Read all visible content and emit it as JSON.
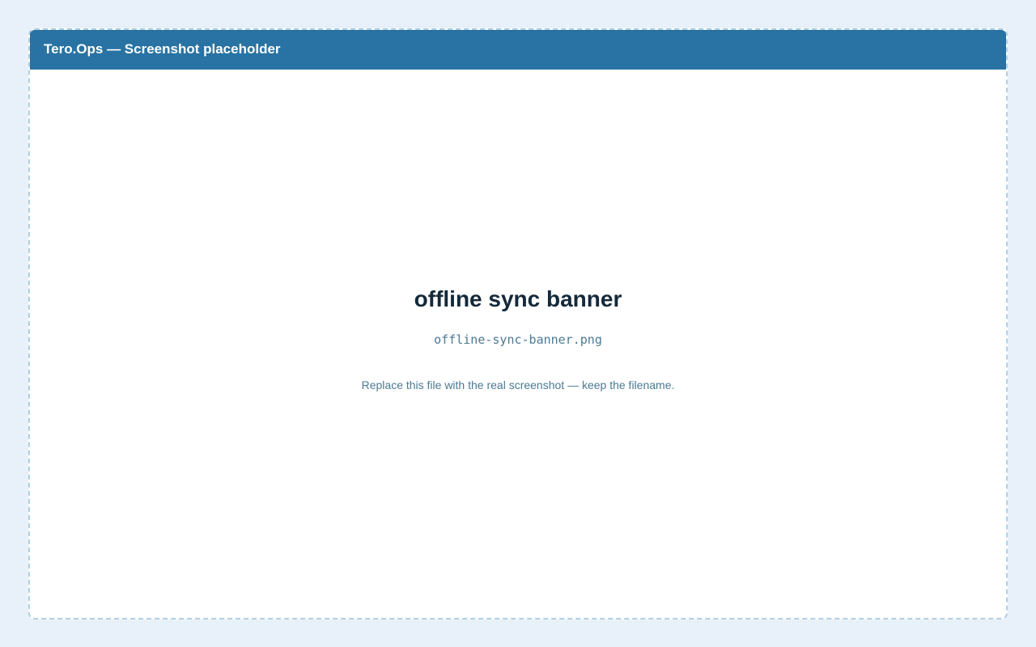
{
  "window": {
    "title": "Tero.Ops — Screenshot placeholder"
  },
  "placeholder": {
    "heading": "offline sync banner",
    "filename": "offline-sync-banner.png",
    "hint": "Replace this file with the real screenshot — keep the filename."
  },
  "colors": {
    "background": "#e8f1f9",
    "titlebar": "#2873a3",
    "border": "#b3cfe2",
    "heading": "#14293a",
    "muted_text": "#4b7a94"
  }
}
